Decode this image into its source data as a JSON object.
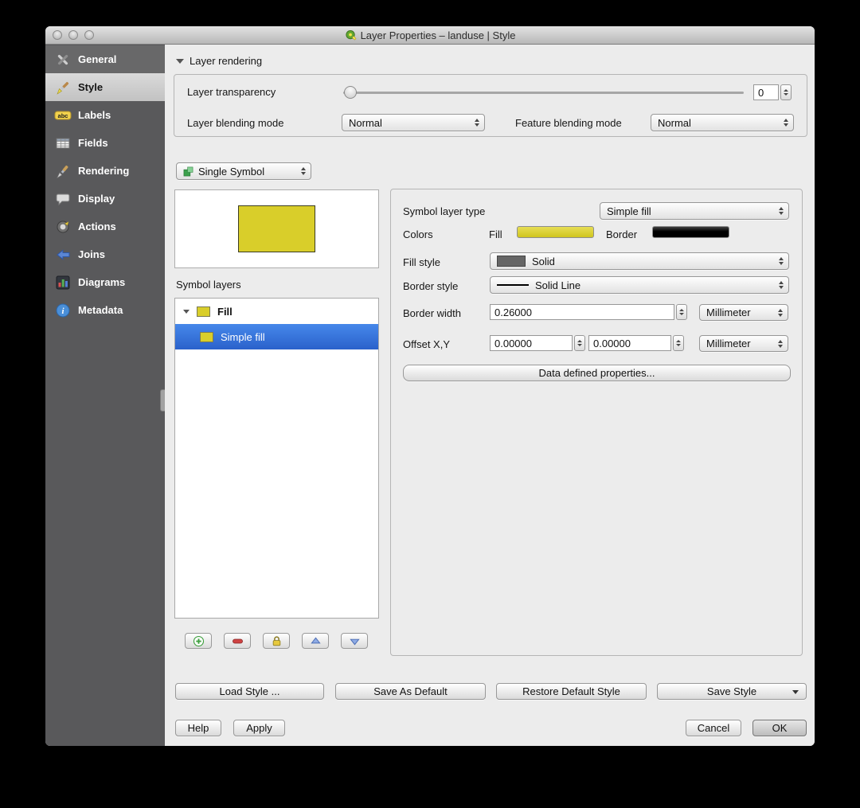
{
  "window": {
    "title": "Layer Properties – landuse | Style"
  },
  "sidebar": {
    "items": [
      {
        "label": "General",
        "icon": "tools-icon"
      },
      {
        "label": "Style",
        "icon": "paintbrush-icon"
      },
      {
        "label": "Labels",
        "icon": "abc-label-icon"
      },
      {
        "label": "Fields",
        "icon": "attribute-table-icon"
      },
      {
        "label": "Rendering",
        "icon": "rendering-brush-icon"
      },
      {
        "label": "Display",
        "icon": "speech-bubble-icon"
      },
      {
        "label": "Actions",
        "icon": "action-gear-icon"
      },
      {
        "label": "Joins",
        "icon": "join-arrow-icon"
      },
      {
        "label": "Diagrams",
        "icon": "diagram-chart-icon"
      },
      {
        "label": "Metadata",
        "icon": "info-icon"
      }
    ]
  },
  "layer_rendering": {
    "header": "Layer rendering",
    "transparency_label": "Layer transparency",
    "transparency_value": "0",
    "layer_blending_label": "Layer blending mode",
    "layer_blending_value": "Normal",
    "feature_blending_label": "Feature blending mode",
    "feature_blending_value": "Normal"
  },
  "renderer": {
    "value": "Single Symbol"
  },
  "symbol": {
    "symbol_layers_label": "Symbol layers",
    "tree": {
      "root": "Fill",
      "child": "Simple fill"
    },
    "toolbar_icons": [
      "plus-icon",
      "minus-icon",
      "lock-icon",
      "up-arrow-icon",
      "down-arrow-icon"
    ]
  },
  "properties": {
    "symbol_layer_type_label": "Symbol layer type",
    "symbol_layer_type_value": "Simple fill",
    "colors_label": "Colors",
    "fill_label": "Fill",
    "border_label": "Border",
    "fill_style_label": "Fill style",
    "fill_style_value": "Solid",
    "border_style_label": "Border style",
    "border_style_value": "Solid Line",
    "border_width_label": "Border width",
    "border_width_value": "0.26000",
    "border_width_unit": "Millimeter",
    "offset_label": "Offset X,Y",
    "offset_x_value": "0.00000",
    "offset_y_value": "0.00000",
    "offset_unit": "Millimeter",
    "data_defined_button": "Data defined properties..."
  },
  "style_buttons": {
    "load": "Load Style ...",
    "save_as_default": "Save As Default",
    "restore_default": "Restore Default Style",
    "save_style": "Save Style"
  },
  "footer": {
    "help": "Help",
    "apply": "Apply",
    "cancel": "Cancel",
    "ok": "OK"
  },
  "colors": {
    "fill": "#d9ce2a",
    "border": "#000000",
    "selection": "#2f6fdc"
  }
}
